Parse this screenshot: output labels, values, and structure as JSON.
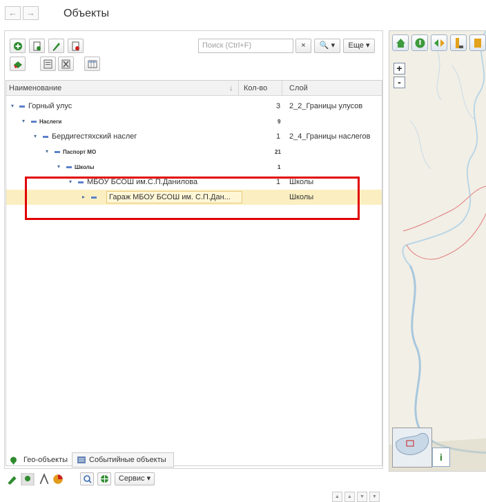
{
  "header": {
    "title": "Объекты",
    "back_icon": "←",
    "forward_icon": "→"
  },
  "toolbar": {
    "search_placeholder": "Поиск (Ctrl+F)",
    "clear_label": "×",
    "search_button_label": "🔍 ▾",
    "more_label": "Еще ▾"
  },
  "table": {
    "columns": {
      "name": "Наименование",
      "sort_indicator": "↓",
      "count": "Кол-во",
      "layer": "Слой"
    },
    "rows": [
      {
        "expander": "▾",
        "name": "Горный улус",
        "count": "3",
        "layer": "2_2_Границы улусов"
      },
      {
        "expander": "▾",
        "name": "Наслеги",
        "count": "9",
        "layer": ""
      },
      {
        "expander": "▾",
        "name": "Бердигестяхский наслег",
        "count": "1",
        "layer": "2_4_Границы наслегов"
      },
      {
        "expander": "▾",
        "name": "Паспорт МО",
        "count": "21",
        "layer": ""
      },
      {
        "expander": "▾",
        "name": "Школы",
        "count": "1",
        "layer": ""
      },
      {
        "expander": "▾",
        "name": "МБОУ БСОШ им.С.П.Данилова",
        "count": "1",
        "layer": "Школы"
      },
      {
        "expander": "▸",
        "name": "Гараж МБОУ БСОШ им. С.П.Дан...",
        "count": "",
        "layer": "Школы"
      }
    ]
  },
  "tabs": {
    "geo": "Гео-объекты",
    "events": "Событийные объекты"
  },
  "bottom_toolbar": {
    "service_label": "Сервис ▾"
  },
  "map": {
    "zoom_in": "+",
    "zoom_out": "-",
    "info_label": "i"
  },
  "colors": {
    "highlight_box": "#e10000",
    "selected_row": "#fbefc2",
    "accent": "#5b80c9"
  }
}
